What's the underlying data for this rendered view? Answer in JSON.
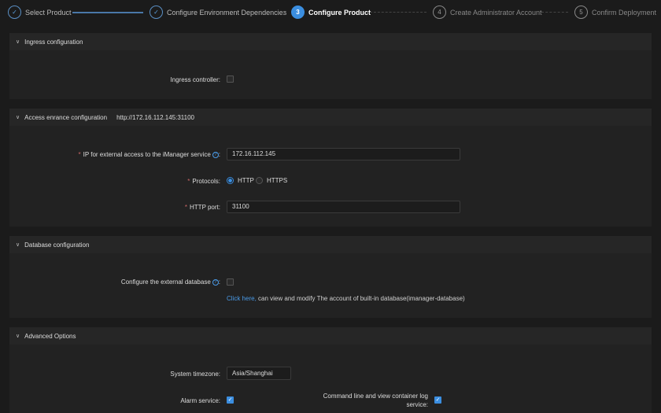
{
  "steps": [
    {
      "num": "✓",
      "label": "Select Product",
      "state": "done"
    },
    {
      "num": "✓",
      "label": "Configure Environment Dependencies",
      "state": "done"
    },
    {
      "num": "3",
      "label": "Configure Product",
      "state": "active"
    },
    {
      "num": "4",
      "label": "Create Administrator Account",
      "state": "todo"
    },
    {
      "num": "5",
      "label": "Confirm Deployment",
      "state": "todo"
    }
  ],
  "ingress": {
    "title": "Ingress configuration",
    "controller_label": "Ingress controller:",
    "controller_checked": false
  },
  "access": {
    "title": "Access enrance configuration",
    "url": "http://172.16.112.145:31100",
    "ip_label": "IP for external access to the iManager service",
    "ip_value": "172.16.112.145",
    "protocols_label": "Protocols:",
    "protocol_options": [
      "HTTP",
      "HTTPS"
    ],
    "protocol_selected": "HTTP",
    "port_label": "HTTP port:",
    "port_value": "31100",
    "help": "?",
    "colon": ":"
  },
  "database": {
    "title": "Database configuration",
    "external_label": "Configure the external database",
    "external_checked": false,
    "link": "Click here,",
    "hint": " can view and modify The account of built-in database(imanager-database)"
  },
  "advanced": {
    "title": "Advanced Options",
    "timezone_label": "System timezone:",
    "timezone_value": "Asia/Shanghai",
    "alarm_label": "Alarm service:",
    "alarm_checked": true,
    "cmd_label_1": "Command line and view container log",
    "cmd_label_2": "service:",
    "cmd_checked": true
  },
  "icons": {
    "chevron": "chevron-down-icon",
    "check": "✓"
  },
  "colors": {
    "accent": "#3b8ee0"
  }
}
